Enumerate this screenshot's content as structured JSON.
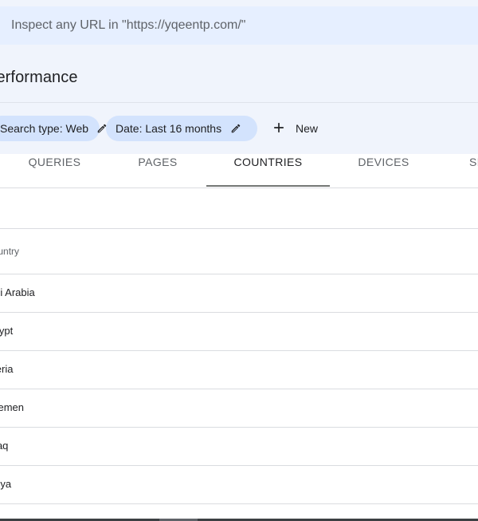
{
  "search": {
    "placeholder": "Inspect any URL in \"https://yqeentp.com/\""
  },
  "header": {
    "title": "Performance"
  },
  "filters": {
    "chips": [
      {
        "label": "Search type: Web",
        "icon": "pencil-icon"
      },
      {
        "label": "Date: Last 16 months",
        "icon": "pencil-icon"
      }
    ],
    "new_label": "New"
  },
  "tabs": [
    "QUERIES",
    "PAGES",
    "COUNTRIES",
    "DEVICES",
    "SEARCH APPEARANCE"
  ],
  "active_tab": "COUNTRIES",
  "table": {
    "column_header": "Country",
    "rows": [
      "Saudi Arabia",
      "Egypt",
      "Algeria",
      "Yemen",
      "Iraq",
      "Libya"
    ]
  },
  "colors": {
    "accent_chip": "#d3e3fd",
    "search_bar": "#e6efff",
    "header_bg": "#f0f4fc",
    "tab_indicator": "#747775"
  }
}
